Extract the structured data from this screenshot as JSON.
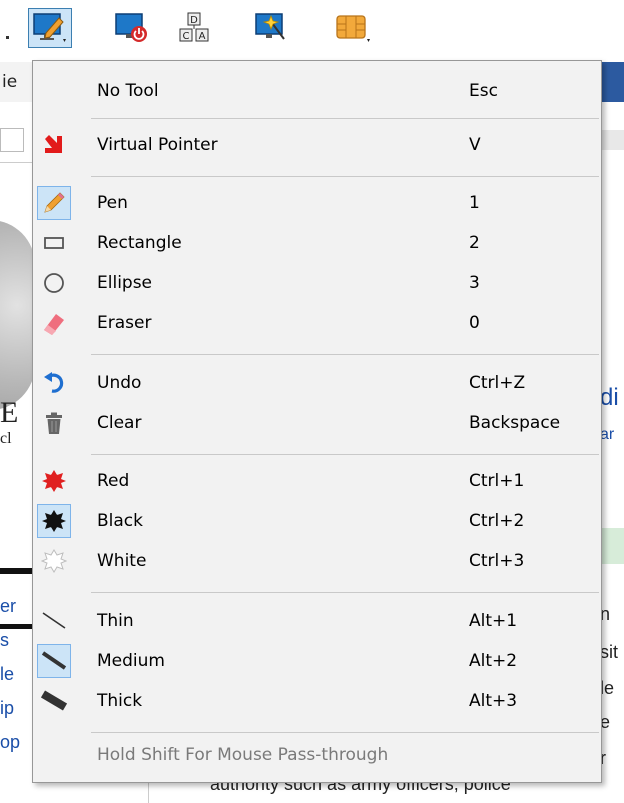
{
  "toolbar": {
    "buttons": [
      {
        "icon": "monitor-pen-icon",
        "active": true
      },
      {
        "icon": "monitor-power-icon",
        "active": false
      },
      {
        "icon": "dca-nodes-icon",
        "active": false
      },
      {
        "icon": "monitor-magic-wand-icon",
        "active": false
      },
      {
        "icon": "sim-chip-icon",
        "active": false
      }
    ]
  },
  "background": {
    "left_fragments": [
      "ie",
      "E",
      "cl",
      "er",
      "s",
      "le",
      "ip",
      "op"
    ],
    "right_fragments": [
      "di",
      "ar",
      "n",
      "sit",
      "le",
      "e",
      "r"
    ],
    "bottom_text": "authority such as army officers, police"
  },
  "menu": {
    "items": [
      {
        "label": "No Tool",
        "shortcut": "Esc",
        "icon": "none"
      },
      {
        "label": "Virtual Pointer",
        "shortcut": "V",
        "icon": "red-arrow-pointer-icon"
      },
      {
        "label": "Pen",
        "shortcut": "1",
        "icon": "pencil-icon",
        "checked": true
      },
      {
        "label": "Rectangle",
        "shortcut": "2",
        "icon": "rectangle-icon"
      },
      {
        "label": "Ellipse",
        "shortcut": "3",
        "icon": "ellipse-icon"
      },
      {
        "label": "Eraser",
        "shortcut": "0",
        "icon": "eraser-icon"
      },
      {
        "label": "Undo",
        "shortcut": "Ctrl+Z",
        "icon": "undo-arrow-icon"
      },
      {
        "label": "Clear",
        "shortcut": "Backspace",
        "icon": "trash-icon"
      },
      {
        "label": "Red",
        "shortcut": "Ctrl+1",
        "icon": "red-splat-icon"
      },
      {
        "label": "Black",
        "shortcut": "Ctrl+2",
        "icon": "black-splat-icon",
        "checked": true
      },
      {
        "label": "White",
        "shortcut": "Ctrl+3",
        "icon": "white-splat-icon"
      },
      {
        "label": "Thin",
        "shortcut": "Alt+1",
        "icon": "thin-line-icon"
      },
      {
        "label": "Medium",
        "shortcut": "Alt+2",
        "icon": "medium-line-icon",
        "checked": true
      },
      {
        "label": "Thick",
        "shortcut": "Alt+3",
        "icon": "thick-line-icon"
      }
    ],
    "footer": "Hold Shift For Mouse Pass-through"
  },
  "colors": {
    "menu_bg": "#f2f2f2",
    "checked_bg": "#cce4f7",
    "pointer_red": "#e21b1b",
    "pencil_orange": "#f0a030",
    "eraser_pink": "#ef6e7e",
    "undo_blue": "#1f6fd0",
    "paint_red": "#e02020",
    "footer_gray": "#7a7a7a"
  }
}
